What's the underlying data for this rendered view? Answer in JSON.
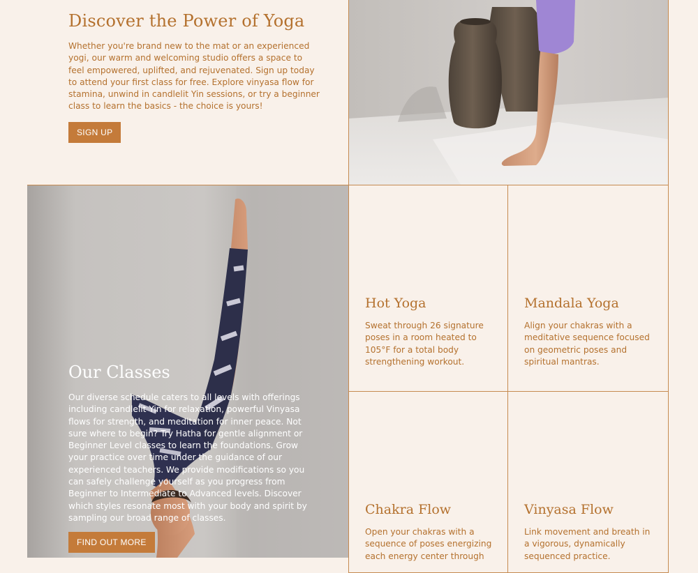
{
  "hero": {
    "title": "Discover the Power of Yoga",
    "body": "Whether you're brand new to the mat or an experienced yogi, our warm and welcoming studio offers a space to feel empowered, uplifted, and rejuvenated. Sign up today to attend your first class for free. Explore vinyasa flow for stamina, unwind in candlelit Yin sessions, or try a beginner class to learn the basics - the choice is yours!",
    "button_label": "SIGN UP"
  },
  "classes": {
    "title": "Our Classes",
    "body": "Our diverse schedule caters to all levels with offerings including candlelit Yin for relaxation, powerful Vinyasa flows for strength, and meditation for inner peace. Not sure where to begin? Try Hatha for gentle alignment or Beginner Level classes to learn the foundations. Grow your practice over time under the guidance of our experienced teachers. We provide modifications so you can safely challenge yourself as you progress from Beginner to Intermediate to Advanced levels. Discover which styles resonate most with your body and spirit by sampling our broad range of classes.",
    "button_label": "FIND OUT MORE",
    "cards": [
      {
        "title": "Hot Yoga",
        "body": "Sweat through 26 signature poses in a room heated to 105°F for a total body strengthening workout."
      },
      {
        "title": "Mandala Yoga",
        "body": "Align your chakras with a meditative sequence focused on geometric poses and spiritual mantras."
      },
      {
        "title": "Chakra Flow",
        "body": "Open your chakras with a sequence of poses energizing each energy center through"
      },
      {
        "title": "Vinyasa Flow",
        "body": "Link movement and breath in a vigorous, dynamically sequenced practice."
      }
    ]
  },
  "colors": {
    "background": "#f9f1ea",
    "accent": "#b4712e",
    "button": "#c47b3a",
    "border": "#c58a50"
  }
}
